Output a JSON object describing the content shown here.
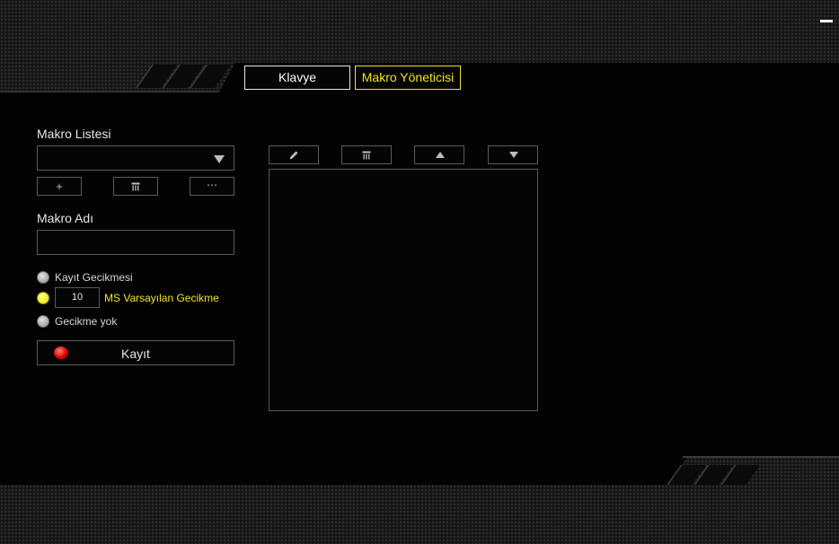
{
  "window": {
    "minimize_icon": "minimize-icon"
  },
  "tabs": [
    {
      "label": "Klavye",
      "active": false
    },
    {
      "label": "Makro Yöneticisi",
      "active": true
    }
  ],
  "macro_list": {
    "label": "Makro Listesi",
    "selected": "",
    "buttons": {
      "add": "+",
      "delete_icon": "trash-icon",
      "more": "⋯"
    }
  },
  "macro_name": {
    "label": "Makro Adı",
    "value": ""
  },
  "delay_options": {
    "record_delay": "Kayıt Gecikmesi",
    "default_delay_value": "10",
    "default_delay_label": "MS Varsayılan Gecikme",
    "no_delay": "Gecikme yok",
    "selected": "default"
  },
  "record_button": {
    "label": "Kayıt"
  },
  "editor_toolbar": {
    "icons": [
      "pencil-icon",
      "trash-icon",
      "move-up-icon",
      "move-down-icon"
    ]
  },
  "event_list": {
    "items": []
  },
  "colors": {
    "accent": "#f2e31f",
    "record": "#e00000",
    "background": "#030303"
  }
}
